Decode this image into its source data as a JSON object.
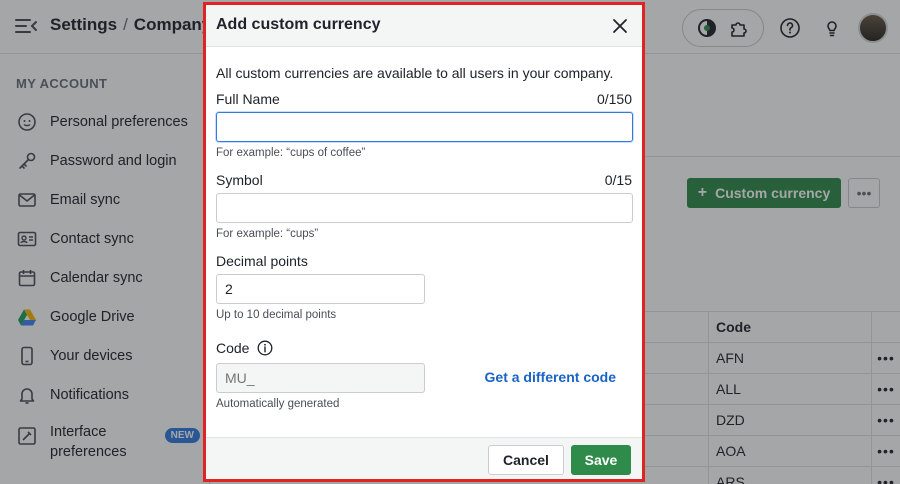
{
  "header": {
    "breadcrumb_root": "Settings",
    "breadcrumb_separator": "/",
    "breadcrumb_current": "Company s"
  },
  "sidebar": {
    "section_title": "MY ACCOUNT",
    "items": [
      {
        "label": "Personal preferences",
        "icon": "person-icon"
      },
      {
        "label": "Password and login",
        "icon": "key-icon"
      },
      {
        "label": "Email sync",
        "icon": "envelope-icon"
      },
      {
        "label": "Contact sync",
        "icon": "contact-card-icon"
      },
      {
        "label": "Calendar sync",
        "icon": "calendar-icon"
      },
      {
        "label": "Google Drive",
        "icon": "google-drive-icon"
      },
      {
        "label": "Your devices",
        "icon": "phone-icon"
      },
      {
        "label": "Notifications",
        "icon": "bell-icon"
      },
      {
        "label": "Interface preferences",
        "icon": "interface-icon",
        "badge": "NEW"
      }
    ]
  },
  "main": {
    "add_button_label": "Custom currency",
    "table": {
      "code_header": "Code",
      "rows": [
        "AFN",
        "ALL",
        "DZD",
        "AOA",
        "ARS"
      ]
    }
  },
  "modal": {
    "title": "Add custom currency",
    "intro": "All custom currencies are available to all users in your company.",
    "full_name": {
      "label": "Full Name",
      "counter": "0/150",
      "value": "",
      "hint": "For example: “cups of coffee”"
    },
    "symbol": {
      "label": "Symbol",
      "counter": "0/15",
      "value": "",
      "hint": "For example: “cups”"
    },
    "decimal_points": {
      "label": "Decimal points",
      "value": "2",
      "hint": "Up to 10 decimal points"
    },
    "code": {
      "label": "Code",
      "placeholder": "MU_",
      "hint": "Automatically generated",
      "link": "Get a different code"
    },
    "footer": {
      "cancel_label": "Cancel",
      "save_label": "Save"
    }
  },
  "colors": {
    "accent_green": "#2e8b4a",
    "link_blue": "#1a63c7",
    "focus_blue": "#317ae2",
    "highlight_red": "#e02424"
  }
}
